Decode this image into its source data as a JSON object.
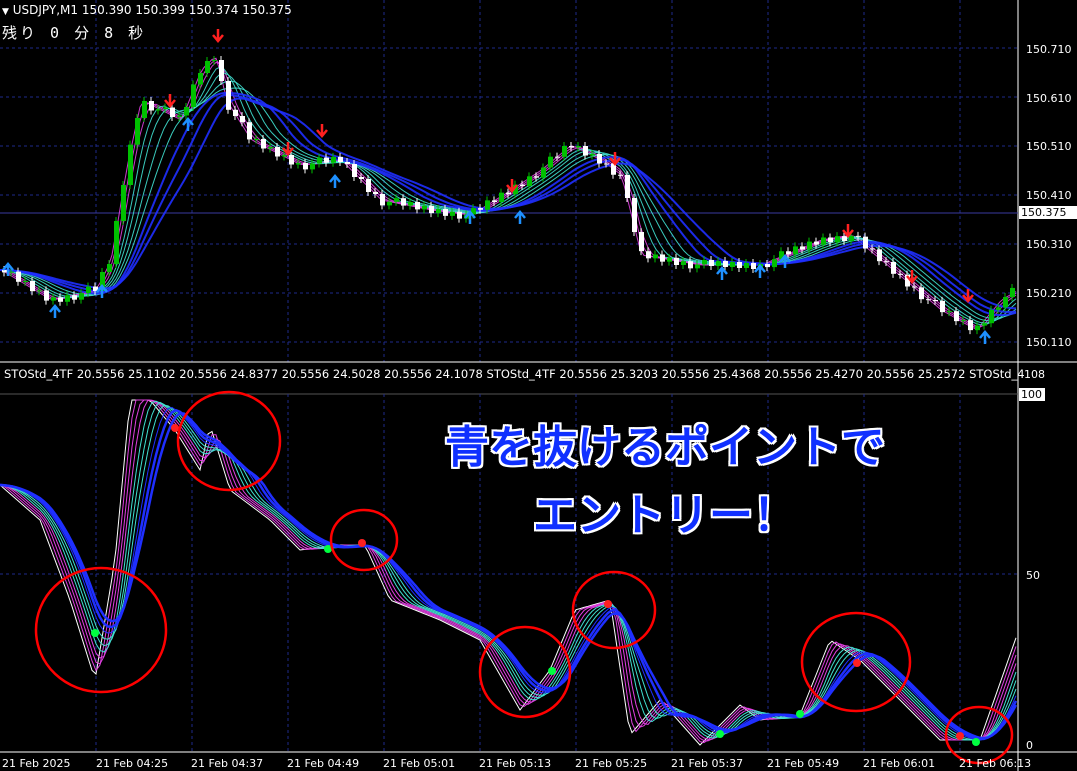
{
  "header": {
    "menu_arrow_icon": "triangle-down-icon",
    "instrument": "USDJPY,M1",
    "ohlc": "150.390 150.399 150.374 150.375",
    "countdown": "残り 0 分 8 秒"
  },
  "price_axis": {
    "ticks": [
      "150.710",
      "150.610",
      "150.510",
      "150.410",
      "150.310",
      "150.210",
      "150.110"
    ],
    "current_price": "150.375"
  },
  "indicator": {
    "header": "STOStd_4TF 20.5556 25.1102 20.5556 24.8377 20.5556 24.5028 20.5556 24.1078  STOStd_4TF 20.5556 25.3203 20.5556 25.4368 20.5556 25.4270 20.5556 25.2572  STOStd_4",
    "axis_ticks": {
      "top": "108",
      "max": "100",
      "mid": "50",
      "min": "0"
    }
  },
  "time_axis": {
    "labels": [
      "21 Feb 2025",
      "21 Feb 04:25",
      "21 Feb 04:37",
      "21 Feb 04:49",
      "21 Feb 05:01",
      "21 Feb 05:13",
      "21 Feb 05:25",
      "21 Feb 05:37",
      "21 Feb 05:49",
      "21 Feb 06:01",
      "21 Feb 06:13"
    ]
  },
  "annotation": {
    "line1": "青を抜けるポイントで",
    "line2": "エントリー！"
  },
  "colors": {
    "background": "#000000",
    "bull_candle": "#00c000",
    "bear_candle": "#ffffff",
    "grid": "#1e2a8a",
    "ma_blue": "#1f2fff",
    "ma_magenta": "#e040e0",
    "ma_cyan": "#40e0d0",
    "signal_up": "#1e90ff",
    "signal_down": "#ff2020",
    "circle": "#ff0000",
    "dot_green": "#00ff40",
    "dot_red": "#ff2020",
    "text_annotation": "#1030ff"
  }
}
